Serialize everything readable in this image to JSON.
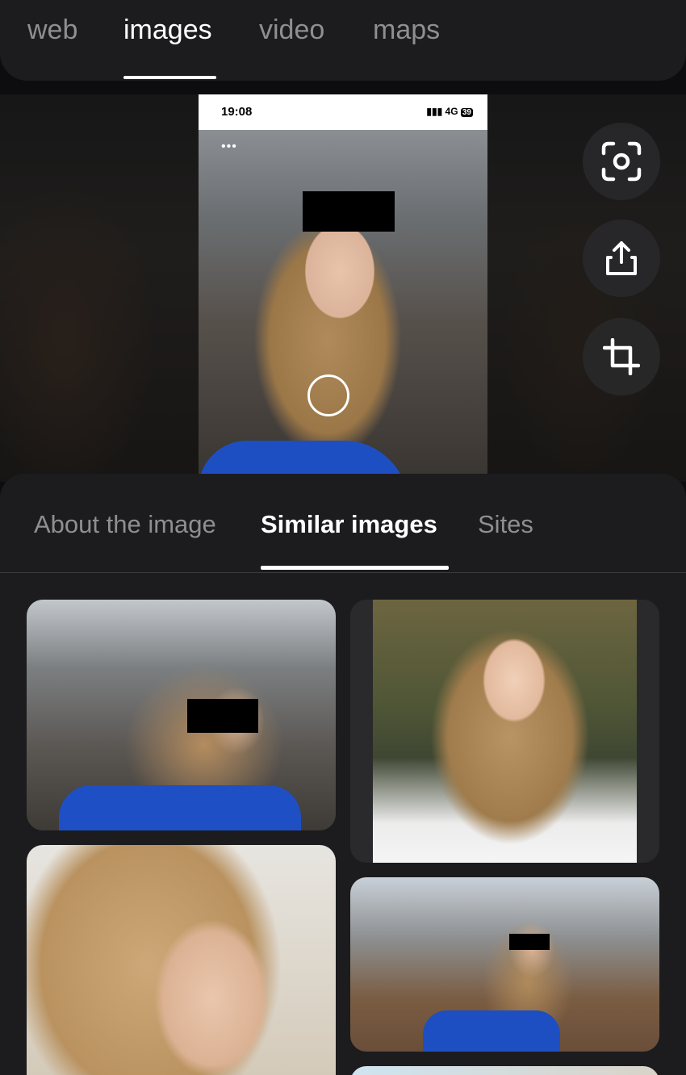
{
  "nav": {
    "tabs": [
      {
        "label": "web"
      },
      {
        "label": "images"
      },
      {
        "label": "video"
      },
      {
        "label": "maps"
      }
    ],
    "active_tab": "images"
  },
  "preview": {
    "status_time": "19:08",
    "status_network": "4G",
    "status_battery": "39",
    "menu_glyph": "•••"
  },
  "actions": [
    {
      "icon": "scan-icon"
    },
    {
      "icon": "share-icon"
    },
    {
      "icon": "crop-icon"
    }
  ],
  "sheet": {
    "tabs": [
      {
        "label": "About the image"
      },
      {
        "label": "Similar images"
      },
      {
        "label": "Sites"
      }
    ],
    "active_tab": "Similar images"
  },
  "colors": {
    "background": "#0d0d0f",
    "panel": "#1c1c1e",
    "active_text": "#ffffff",
    "inactive_text": "#8e8e93"
  }
}
